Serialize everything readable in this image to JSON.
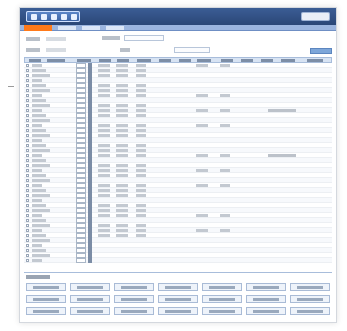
{
  "app": {
    "title": "",
    "header_button": ""
  },
  "nav": {
    "tabs": [
      "",
      "",
      "",
      ""
    ]
  },
  "search": {
    "button_label": ""
  },
  "grid": {
    "columns": 14,
    "row_count": 40,
    "rows_with_notes": [
      9,
      18
    ]
  },
  "footer": {
    "title": "",
    "buttons_row1": [
      "",
      "",
      "",
      "",
      "",
      "",
      ""
    ],
    "buttons_row2": [
      "",
      "",
      "",
      "",
      "",
      "",
      ""
    ],
    "buttons_row3": [
      "",
      "",
      "",
      "",
      "",
      "",
      ""
    ]
  },
  "colors": {
    "header": "#2b4777",
    "nav_active": "#ff7a1a",
    "nav_bar": "#9bb5df",
    "table_header": "#d7e3f3"
  }
}
